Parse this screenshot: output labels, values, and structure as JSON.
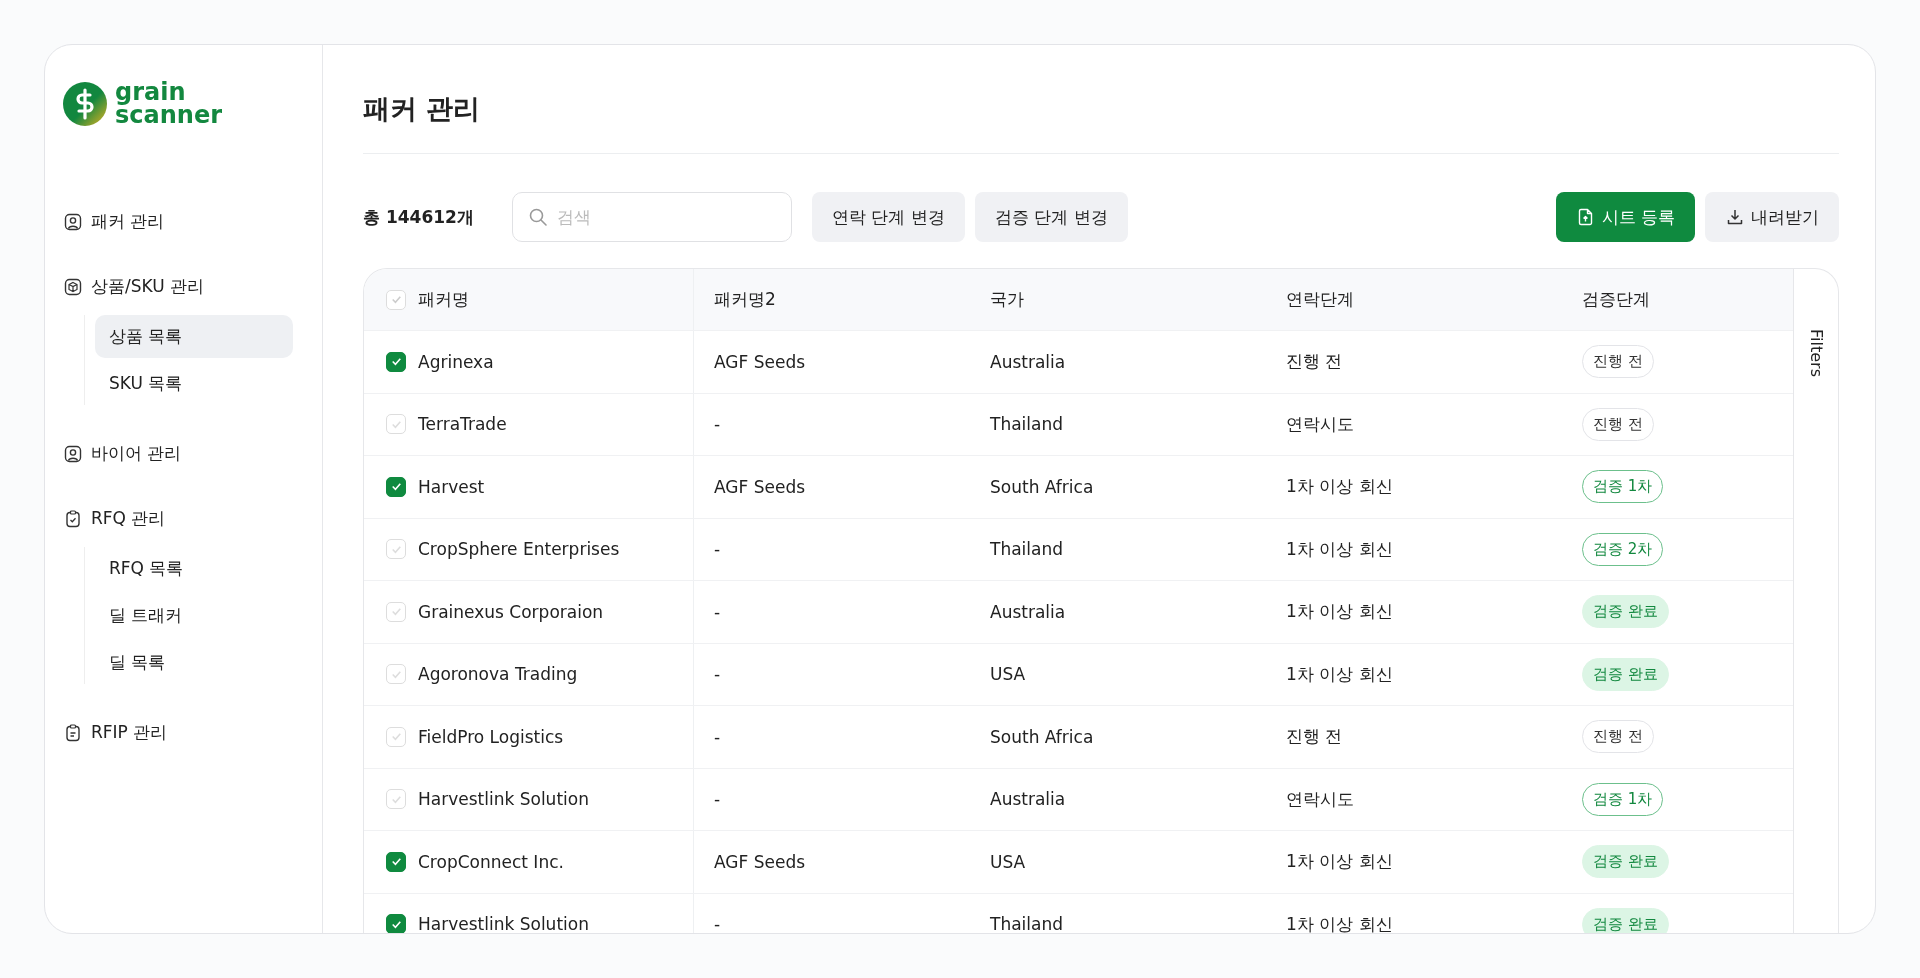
{
  "brand": {
    "line1": "grain",
    "line2": "scanner"
  },
  "sidebar": {
    "items": [
      {
        "label": "패커 관리"
      },
      {
        "label": "상품/SKU 관리",
        "children": [
          {
            "label": "상품 목록",
            "selected": true
          },
          {
            "label": "SKU 목록",
            "selected": false
          }
        ]
      },
      {
        "label": "바이어 관리"
      },
      {
        "label": "RFQ 관리",
        "children": [
          {
            "label": "RFQ 목록",
            "selected": false
          },
          {
            "label": "딜 트래커",
            "selected": false
          },
          {
            "label": "딜 목록",
            "selected": false
          }
        ]
      },
      {
        "label": "RFIP 관리"
      }
    ]
  },
  "page_title": "패커 관리",
  "toolbar": {
    "total": "총 144612개",
    "search": {
      "placeholder": "검색"
    },
    "buttons": [
      "연락 단계 변경",
      "검증 단계 변경"
    ],
    "primary_button": "시트 등록",
    "download_button": "내려받기"
  },
  "table": {
    "header_checked": false,
    "columns": [
      "패커명",
      "패커명2",
      "국가",
      "연락단계",
      "검증단계"
    ],
    "side_tab": "Filters",
    "rows": [
      {
        "checked": true,
        "name": "Agrinexa",
        "name2": "AGF Seeds",
        "country": "Australia",
        "contact": "진행 전",
        "verify": {
          "label": "진행 전",
          "kind": "pending"
        }
      },
      {
        "checked": false,
        "name": "TerraTrade",
        "name2": "-",
        "country": "Thailand",
        "contact": "연락시도",
        "verify": {
          "label": "진행 전",
          "kind": "pending"
        }
      },
      {
        "checked": true,
        "name": "Harvest",
        "name2": "AGF Seeds",
        "country": "South Africa",
        "contact": "1차 이상 회신",
        "verify": {
          "label": "검증 1차",
          "kind": "stage"
        }
      },
      {
        "checked": false,
        "name": "CropSphere Enterprises",
        "name2": "-",
        "country": "Thailand",
        "contact": "1차 이상 회신",
        "verify": {
          "label": "검증 2차",
          "kind": "stage"
        }
      },
      {
        "checked": false,
        "name": "Grainexus Corporaion",
        "name2": "-",
        "country": "Australia",
        "contact": "1차 이상 회신",
        "verify": {
          "label": "검증 완료",
          "kind": "done"
        }
      },
      {
        "checked": false,
        "name": "Agoronova Trading",
        "name2": "-",
        "country": "USA",
        "contact": "1차 이상 회신",
        "verify": {
          "label": "검증 완료",
          "kind": "done"
        }
      },
      {
        "checked": false,
        "name": "FieldPro Logistics",
        "name2": "-",
        "country": "South Africa",
        "contact": "진행 전",
        "verify": {
          "label": "진행 전",
          "kind": "pending"
        }
      },
      {
        "checked": false,
        "name": "Harvestlink Solution",
        "name2": "-",
        "country": "Australia",
        "contact": "연락시도",
        "verify": {
          "label": "검증 1차",
          "kind": "stage"
        }
      },
      {
        "checked": true,
        "name": "CropConnect Inc.",
        "name2": "AGF Seeds",
        "country": "USA",
        "contact": "1차 이상 회신",
        "verify": {
          "label": "검증 완료",
          "kind": "done"
        }
      },
      {
        "checked": true,
        "name": "Harvestlink Solution",
        "name2": "-",
        "country": "Thailand",
        "contact": "1차 이상 회신",
        "verify": {
          "label": "검증 완료",
          "kind": "done"
        }
      }
    ]
  }
}
